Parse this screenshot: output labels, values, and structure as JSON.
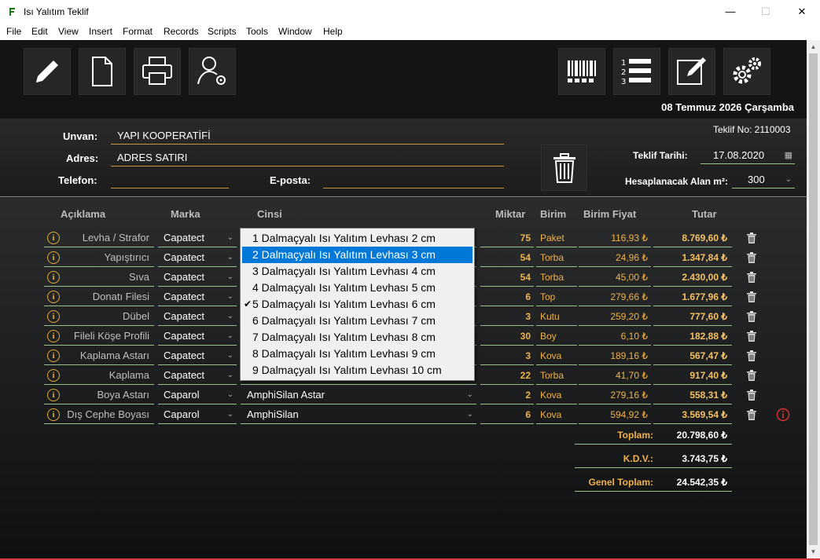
{
  "window": {
    "title": "Isı Yalıtım Teklif",
    "min": "—",
    "max": "☐",
    "close": "✕"
  },
  "menu": [
    "File",
    "Edit",
    "View",
    "Insert",
    "Format",
    "Records",
    "Scripts",
    "Tools",
    "Window",
    "Help"
  ],
  "toolbar": {
    "left_icons": [
      "pencil-icon",
      "new-document-icon",
      "printer-icon",
      "user-settings-icon"
    ],
    "right_icons": [
      "barcode-icon",
      "numbered-list-icon",
      "edit-note-icon",
      "settings-gear-icon"
    ]
  },
  "header": {
    "date": "08 Temmuz 2026 Çarşamba"
  },
  "form": {
    "unvan_label": "Unvan:",
    "unvan_value": "YAPI KOOPERATİFİ",
    "adres_label": "Adres:",
    "adres_value": "ADRES SATIRI",
    "telefon_label": "Telefon:",
    "telefon_value": "",
    "eposta_label": "E-posta:",
    "eposta_value": "",
    "teklif_no": "Teklif No: 2110003",
    "teklif_tarihi_label": "Teklif Tarihi:",
    "teklif_tarihi_value": "17.08.2020",
    "alan_label": "Hesaplanacak Alan m²:",
    "alan_value": "300"
  },
  "columns": {
    "aciklama": "Açıklama",
    "marka": "Marka",
    "cinsi": "Cinsi",
    "miktar": "Miktar",
    "birim": "Birim",
    "birim_fiyat": "Birim Fiyat",
    "tutar": "Tutar"
  },
  "rows": [
    {
      "desc": "Levha / Strafor",
      "marka": "Capatect",
      "cinsi": "",
      "miktar": "75",
      "birim": "Paket",
      "fiyat": "116,93 ₺",
      "tutar": "8.769,60 ₺"
    },
    {
      "desc": "Yapıştırıcı",
      "marka": "Capatect",
      "cinsi": "",
      "miktar": "54",
      "birim": "Torba",
      "fiyat": "24,96 ₺",
      "tutar": "1.347,84 ₺"
    },
    {
      "desc": "Sıva",
      "marka": "Capatect",
      "cinsi": "",
      "miktar": "54",
      "birim": "Torba",
      "fiyat": "45,00 ₺",
      "tutar": "2.430,00 ₺"
    },
    {
      "desc": "Donatı Filesi",
      "marka": "Capatect",
      "cinsi": "",
      "miktar": "6",
      "birim": "Top",
      "fiyat": "279,66 ₺",
      "tutar": "1.677,96 ₺"
    },
    {
      "desc": "Dübel",
      "marka": "Capatect",
      "cinsi": "",
      "miktar": "3",
      "birim": "Kutu",
      "fiyat": "259,20 ₺",
      "tutar": "777,60 ₺"
    },
    {
      "desc": "Fileli Köşe Profili",
      "marka": "Capatect",
      "cinsi": "",
      "miktar": "30",
      "birim": "Boy",
      "fiyat": "6,10 ₺",
      "tutar": "182,88 ₺"
    },
    {
      "desc": "Kaplama Astarı",
      "marka": "Capatect",
      "cinsi": "",
      "miktar": "3",
      "birim": "Kova",
      "fiyat": "189,16 ₺",
      "tutar": "567,47 ₺"
    },
    {
      "desc": "Kaplama",
      "marka": "Capatect",
      "cinsi": "",
      "miktar": "22",
      "birim": "Torba",
      "fiyat": "41,70 ₺",
      "tutar": "917,40 ₺"
    },
    {
      "desc": "Boya Astarı",
      "marka": "Caparol",
      "cinsi": "AmphiSilan Astar",
      "miktar": "2",
      "birim": "Kova",
      "fiyat": "279,16 ₺",
      "tutar": "558,31 ₺"
    },
    {
      "desc": "Dış Cephe Boyası",
      "marka": "Caparol",
      "cinsi": "AmphiSilan",
      "miktar": "6",
      "birim": "Kova",
      "fiyat": "594,92 ₺",
      "tutar": "3.569,54 ₺"
    }
  ],
  "info_glyph": "i",
  "totals": [
    {
      "label": "Toplam:",
      "value": "20.798,60 ₺"
    },
    {
      "label": "K.D.V.:",
      "value": "3.743,75 ₺"
    },
    {
      "label": "Genel Toplam:",
      "value": "24.542,35 ₺"
    }
  ],
  "dropdown": {
    "items": [
      "1 Dalmaçyalı Isı Yalıtım Levhası 2 cm",
      "2 Dalmaçyalı Isı Yalıtım Levhası 3 cm",
      "3 Dalmaçyalı Isı Yalıtım Levhası 4 cm",
      "4 Dalmaçyalı Isı Yalıtım Levhası 5 cm",
      "5 Dalmaçyalı Isı Yalıtım Levhası 6 cm",
      "6 Dalmaçyalı Isı Yalıtım Levhası 7 cm",
      "7 Dalmaçyalı Isı Yalıtım Levhası 8 cm",
      "8 Dalmaçyalı Isı Yalıtım Levhası 9 cm",
      "9 Dalmaçyalı Isı Yalıtım Levhası 10 cm"
    ],
    "highlighted_index": 1,
    "checked_index": 4
  },
  "colors": {
    "accent": "#f0b24a",
    "highlight": "#0078d7",
    "row_line": "#9ac08c",
    "warning": "#e03030"
  }
}
